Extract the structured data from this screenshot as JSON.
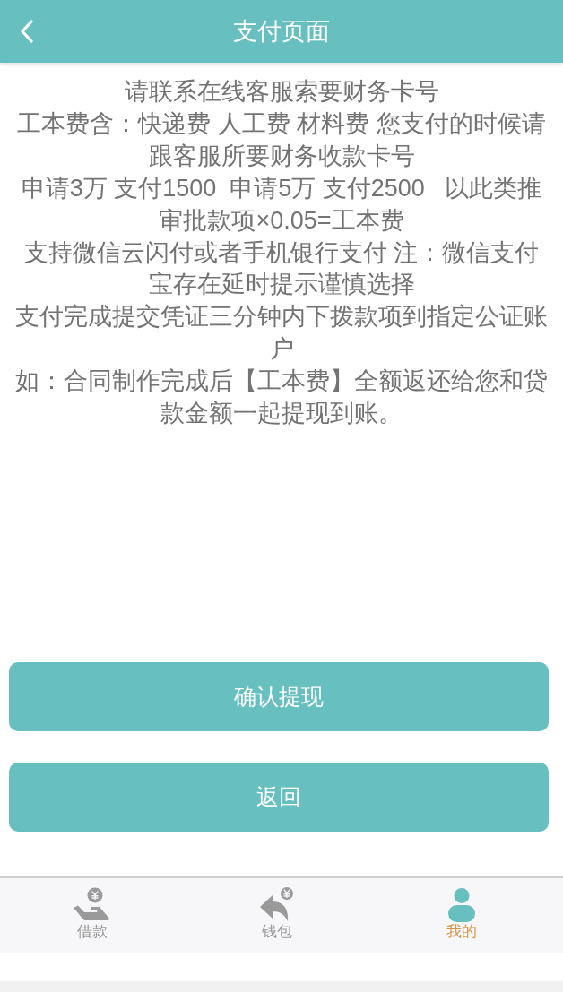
{
  "header": {
    "title": "支付页面"
  },
  "notice": [
    "请联系在线客服索要财务卡号",
    "工本费含：快递费 人工费 材料费 您支付的时候请跟客服所要财务收款卡号",
    "申请3万 支付1500  申请5万 支付2500   以此类推",
    "审批款项×0.05=工本费",
    "支持微信云闪付或者手机银行支付 注：微信支付宝存在延时提示谨慎选择",
    "支付完成提交凭证三分钟内下拨款项到指定公证账户",
    "如：合同制作完成后【工本费】全额返还给您和贷款金额一起提现到账。"
  ],
  "buttons": [
    {
      "label": "确认提现"
    },
    {
      "label": "返回"
    }
  ],
  "tab_bar": {
    "tabs": [
      {
        "label": "借款",
        "selected": false
      },
      {
        "label": "钱包",
        "selected": false
      },
      {
        "label": "我的",
        "selected": true
      }
    ]
  }
}
